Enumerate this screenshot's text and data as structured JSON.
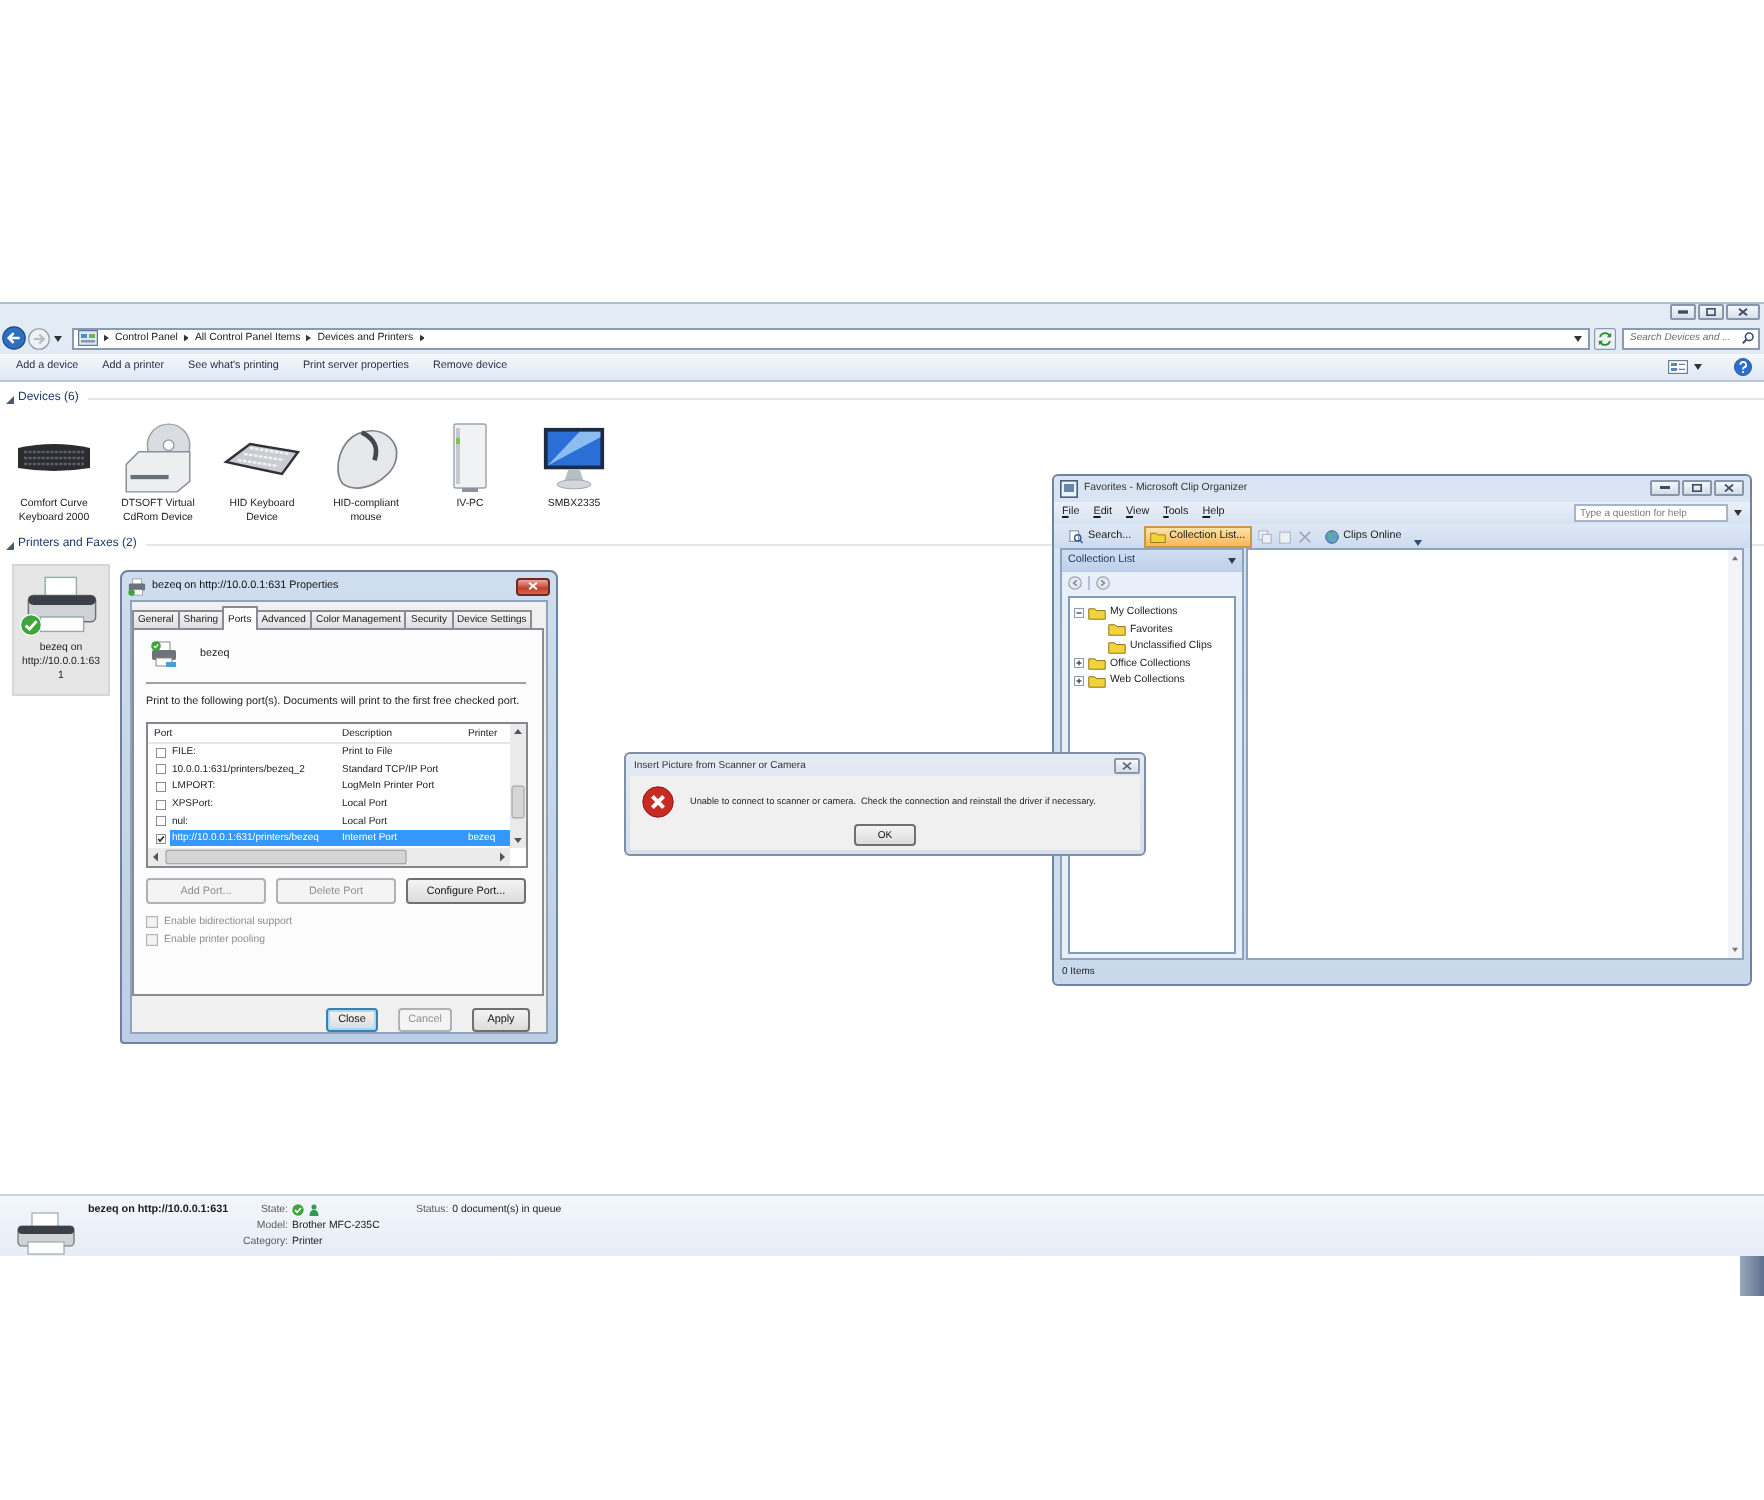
{
  "explorer": {
    "breadcrumbs": [
      "Control Panel",
      "All Control Panel Items",
      "Devices and Printers"
    ],
    "search_placeholder": "Search Devices and ...",
    "commands": [
      "Add a device",
      "Add a printer",
      "See what's printing",
      "Print server properties",
      "Remove device"
    ],
    "groups": [
      {
        "title": "Devices (6)",
        "expanded": true,
        "items": [
          {
            "label": "Comfort Curve Keyboard 2000",
            "kind": "keyboard",
            "selected": false,
            "default": false
          },
          {
            "label": "DTSOFT Virtual CdRom Device",
            "kind": "drive",
            "selected": false,
            "default": false
          },
          {
            "label": "HID Keyboard Device",
            "kind": "silverkeyboard",
            "selected": false,
            "default": false
          },
          {
            "label": "HID-compliant mouse",
            "kind": "mouse",
            "selected": false,
            "default": false
          },
          {
            "label": "IV-PC",
            "kind": "tower",
            "selected": false,
            "default": false
          },
          {
            "label": "SMBX2335",
            "kind": "monitor",
            "selected": false,
            "default": false
          }
        ]
      },
      {
        "title": "Printers and Faxes (2)",
        "expanded": true,
        "items": [
          {
            "label": "bezeq on http://10.0.0.1:631",
            "kind": "printer",
            "selected": true,
            "default": true
          }
        ]
      }
    ],
    "details": {
      "name": "bezeq on http://10.0.0.1:631",
      "fields": [
        {
          "label": "State:",
          "kind": "icons"
        },
        {
          "label": "Model:",
          "kind": "text",
          "value": "Brother MFC-235C"
        },
        {
          "label": "Category:",
          "kind": "text",
          "value": "Printer"
        }
      ],
      "status": {
        "label": "Status:",
        "value": "0 document(s) in queue"
      }
    }
  },
  "properties_dialog": {
    "title": "bezeq on http://10.0.0.1:631 Properties",
    "tabs": [
      {
        "label": "General",
        "selected": false
      },
      {
        "label": "Sharing",
        "selected": false
      },
      {
        "label": "Ports",
        "selected": true
      },
      {
        "label": "Advanced",
        "selected": false
      },
      {
        "label": "Color Management",
        "selected": false
      },
      {
        "label": "Security",
        "selected": false
      },
      {
        "label": "Device Settings",
        "selected": false
      }
    ],
    "printer_name": "bezeq",
    "instruction": "Print to the following port(s). Documents will print to the first free checked port.",
    "columns": [
      "Port",
      "Description",
      "Printer"
    ],
    "ports": [
      {
        "port": "FILE:",
        "description": "Print to File",
        "checked": false,
        "selected": false
      },
      {
        "port": "10.0.0.1:631/printers/bezeq_2",
        "description": "Standard TCP/IP Port",
        "checked": false,
        "selected": false
      },
      {
        "port": "LMPORT:",
        "description": "LogMeIn Printer Port",
        "checked": false,
        "selected": false
      },
      {
        "port": "XPSPort:",
        "description": "Local Port",
        "checked": false,
        "selected": false
      },
      {
        "port": "nul:",
        "description": "Local Port",
        "checked": false,
        "selected": false
      },
      {
        "port": "http://10.0.0.1:631/printers/bezeq",
        "description": "Internet Port",
        "printer": "bezeq",
        "checked": true,
        "selected": true
      }
    ],
    "port_buttons": [
      {
        "label": "Add Port...",
        "disabled": true
      },
      {
        "label": "Delete Port",
        "disabled": true
      },
      {
        "label": "Configure Port...",
        "disabled": false
      }
    ],
    "options": [
      {
        "label": "Enable bidirectional support",
        "checked": false,
        "disabled": true
      },
      {
        "label": "Enable printer pooling",
        "checked": false,
        "disabled": true
      }
    ],
    "footer_buttons": [
      {
        "label": "Close",
        "disabled": false,
        "default": true
      },
      {
        "label": "Cancel",
        "disabled": true,
        "default": false
      },
      {
        "label": "Apply",
        "disabled": false,
        "default": false
      }
    ]
  },
  "error_dialog": {
    "title": "Insert Picture from Scanner or Camera",
    "message": "Unable to connect to scanner or camera.  Check the connection and reinstall the driver if necessary.",
    "button": "OK"
  },
  "clip_organizer": {
    "title": "Favorites - Microsoft Clip Organizer",
    "menu": [
      "File",
      "Edit",
      "View",
      "Tools",
      "Help"
    ],
    "help_placeholder": "Type a question for help",
    "toolbar": [
      {
        "label": "Search...",
        "selected": false
      },
      {
        "label": "Collection List...",
        "selected": true
      },
      {
        "label": "Clips Online",
        "selected": false
      }
    ],
    "pane_title": "Collection List",
    "tree": [
      {
        "label": "My Collections",
        "expanded": true,
        "children": [
          {
            "label": "Favorites"
          },
          {
            "label": "Unclassified Clips"
          }
        ]
      },
      {
        "label": "Office Collections",
        "expanded": false
      },
      {
        "label": "Web Collections",
        "expanded": false
      }
    ],
    "status": "0 Items"
  }
}
